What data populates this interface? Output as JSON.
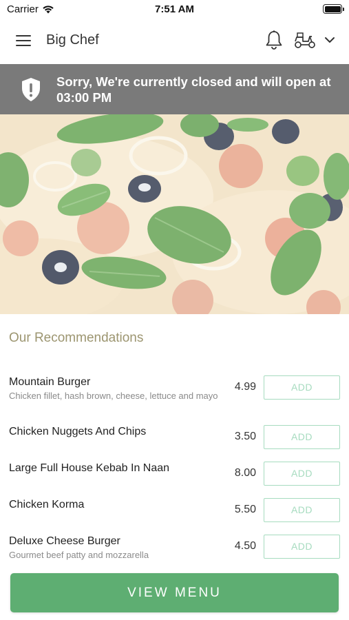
{
  "status_bar": {
    "carrier": "Carrier",
    "time": "7:51 AM",
    "icons": [
      "wifi-icon",
      "battery-icon"
    ]
  },
  "header": {
    "title": "Big Chef",
    "icons": [
      "hamburger-menu-icon",
      "bell-icon",
      "scooter-icon",
      "chevron-down-icon"
    ]
  },
  "closed_banner": {
    "icon": "shield-alert-icon",
    "message": "Sorry, We're currently closed and will open at 03:00 PM",
    "background_color": "#7a7a7a"
  },
  "hero": {
    "image": "pizza-photo"
  },
  "recommendations": {
    "title": "Our Recommendations",
    "items": [
      {
        "name": "Mountain Burger",
        "description": "Chicken fillet, hash brown, cheese, lettuce and mayo",
        "price": "4.99",
        "button": "ADD"
      },
      {
        "name": "Chicken Nuggets And Chips",
        "description": "",
        "price": "3.50",
        "button": "ADD"
      },
      {
        "name": "Large Full House Kebab In Naan",
        "description": "",
        "price": "8.00",
        "button": "ADD"
      },
      {
        "name": "Chicken Korma",
        "description": "",
        "price": "5.50",
        "button": "ADD"
      },
      {
        "name": "Deluxe Cheese Burger",
        "description": "Gourmet beef patty and mozzarella",
        "price": "4.50",
        "button": "ADD"
      }
    ]
  },
  "footer": {
    "view_menu_label": "VIEW MENU",
    "accent_color": "#5eae72",
    "add_button_color": "#a6dbbf"
  }
}
